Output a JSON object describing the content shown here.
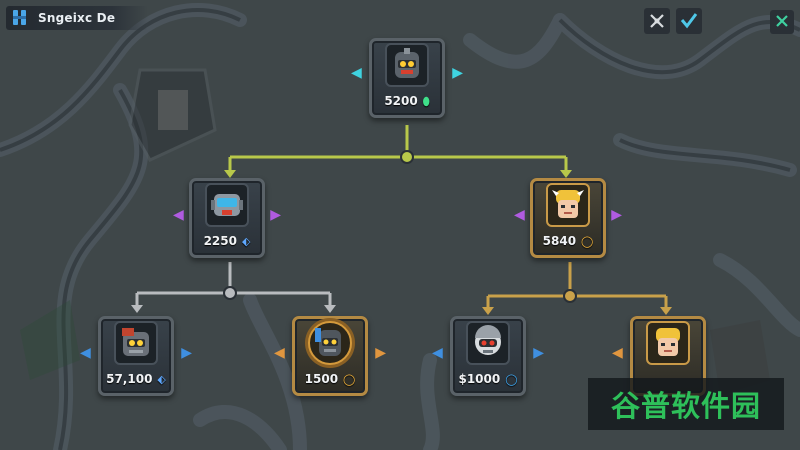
{
  "header": {
    "title": "Sngeixc De",
    "icons": [
      "banner-icon",
      "crossed-swords-icon",
      "checkmark-icon",
      "close-icon"
    ]
  },
  "tree": {
    "root": {
      "cost": "5200",
      "currency": "leaf-icon",
      "accent": "#3fd3e0"
    },
    "left": {
      "cost": "2250",
      "currency": "shield-icon",
      "accent": "#b05be0"
    },
    "right": {
      "cost": "5840",
      "currency": "coin-icon",
      "accent": "#b05be0"
    },
    "left_left": {
      "cost": "57,100",
      "currency": "shield-icon",
      "accent": "#3f8fe0"
    },
    "left_right": {
      "cost": "1500",
      "currency": "coin-icon",
      "accent": "#e0963f"
    },
    "right_left": {
      "cost": "$1000",
      "currency": "coin-icon",
      "accent": "#3f8fe0"
    },
    "right_right": {
      "cost": "",
      "currency": "coin-icon",
      "accent": "#e0963f"
    }
  },
  "colors": {
    "root_link": "#b8c84a",
    "left_link": "#b9bcbf",
    "right_link": "#c9a14a"
  },
  "watermark": "谷普软件园"
}
